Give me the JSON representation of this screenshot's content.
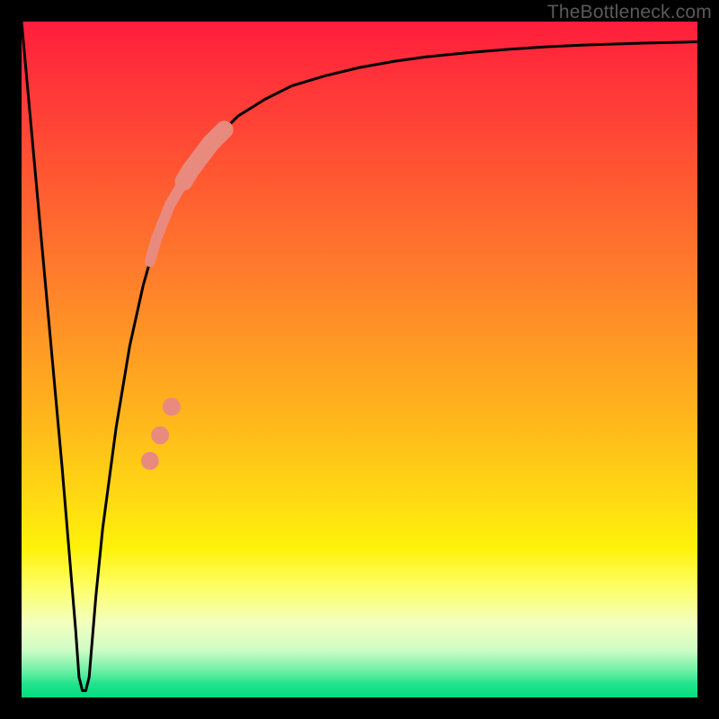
{
  "watermark": "TheBottleneck.com",
  "chart_data": {
    "type": "line",
    "title": "",
    "xlabel": "",
    "ylabel": "",
    "xlim": [
      0,
      100
    ],
    "ylim": [
      0,
      100
    ],
    "grid": false,
    "legend": false,
    "series": [
      {
        "name": "bottleneck-curve",
        "color": "#000000",
        "x": [
          0,
          2,
          4,
          6,
          7,
          8,
          8.5,
          9,
          9.5,
          10,
          10.5,
          11,
          12,
          14,
          16,
          18,
          20,
          22,
          25,
          28,
          32,
          36,
          40,
          45,
          50,
          55,
          60,
          66,
          72,
          78,
          85,
          92,
          100
        ],
        "y": [
          100,
          78,
          56,
          34,
          22,
          10,
          3,
          1,
          1,
          3,
          9,
          15,
          25,
          40,
          52,
          61,
          68,
          73,
          78,
          82,
          86,
          88.5,
          90.5,
          92,
          93.2,
          94.1,
          94.8,
          95.4,
          95.9,
          96.3,
          96.6,
          96.8,
          97
        ]
      }
    ],
    "highlight_segment": {
      "name": "highlighted-range",
      "color": "#e98a7e",
      "x_start": 19,
      "x_end": 30,
      "thick_x_start": 24,
      "thick_x_end": 30
    },
    "highlight_dots": {
      "name": "highlight-dots",
      "color": "#e98a7e",
      "points": [
        {
          "x": 19.0,
          "y": 35.0
        },
        {
          "x": 20.5,
          "y": 38.8
        },
        {
          "x": 22.2,
          "y": 43.0
        }
      ],
      "radius": 10
    }
  }
}
